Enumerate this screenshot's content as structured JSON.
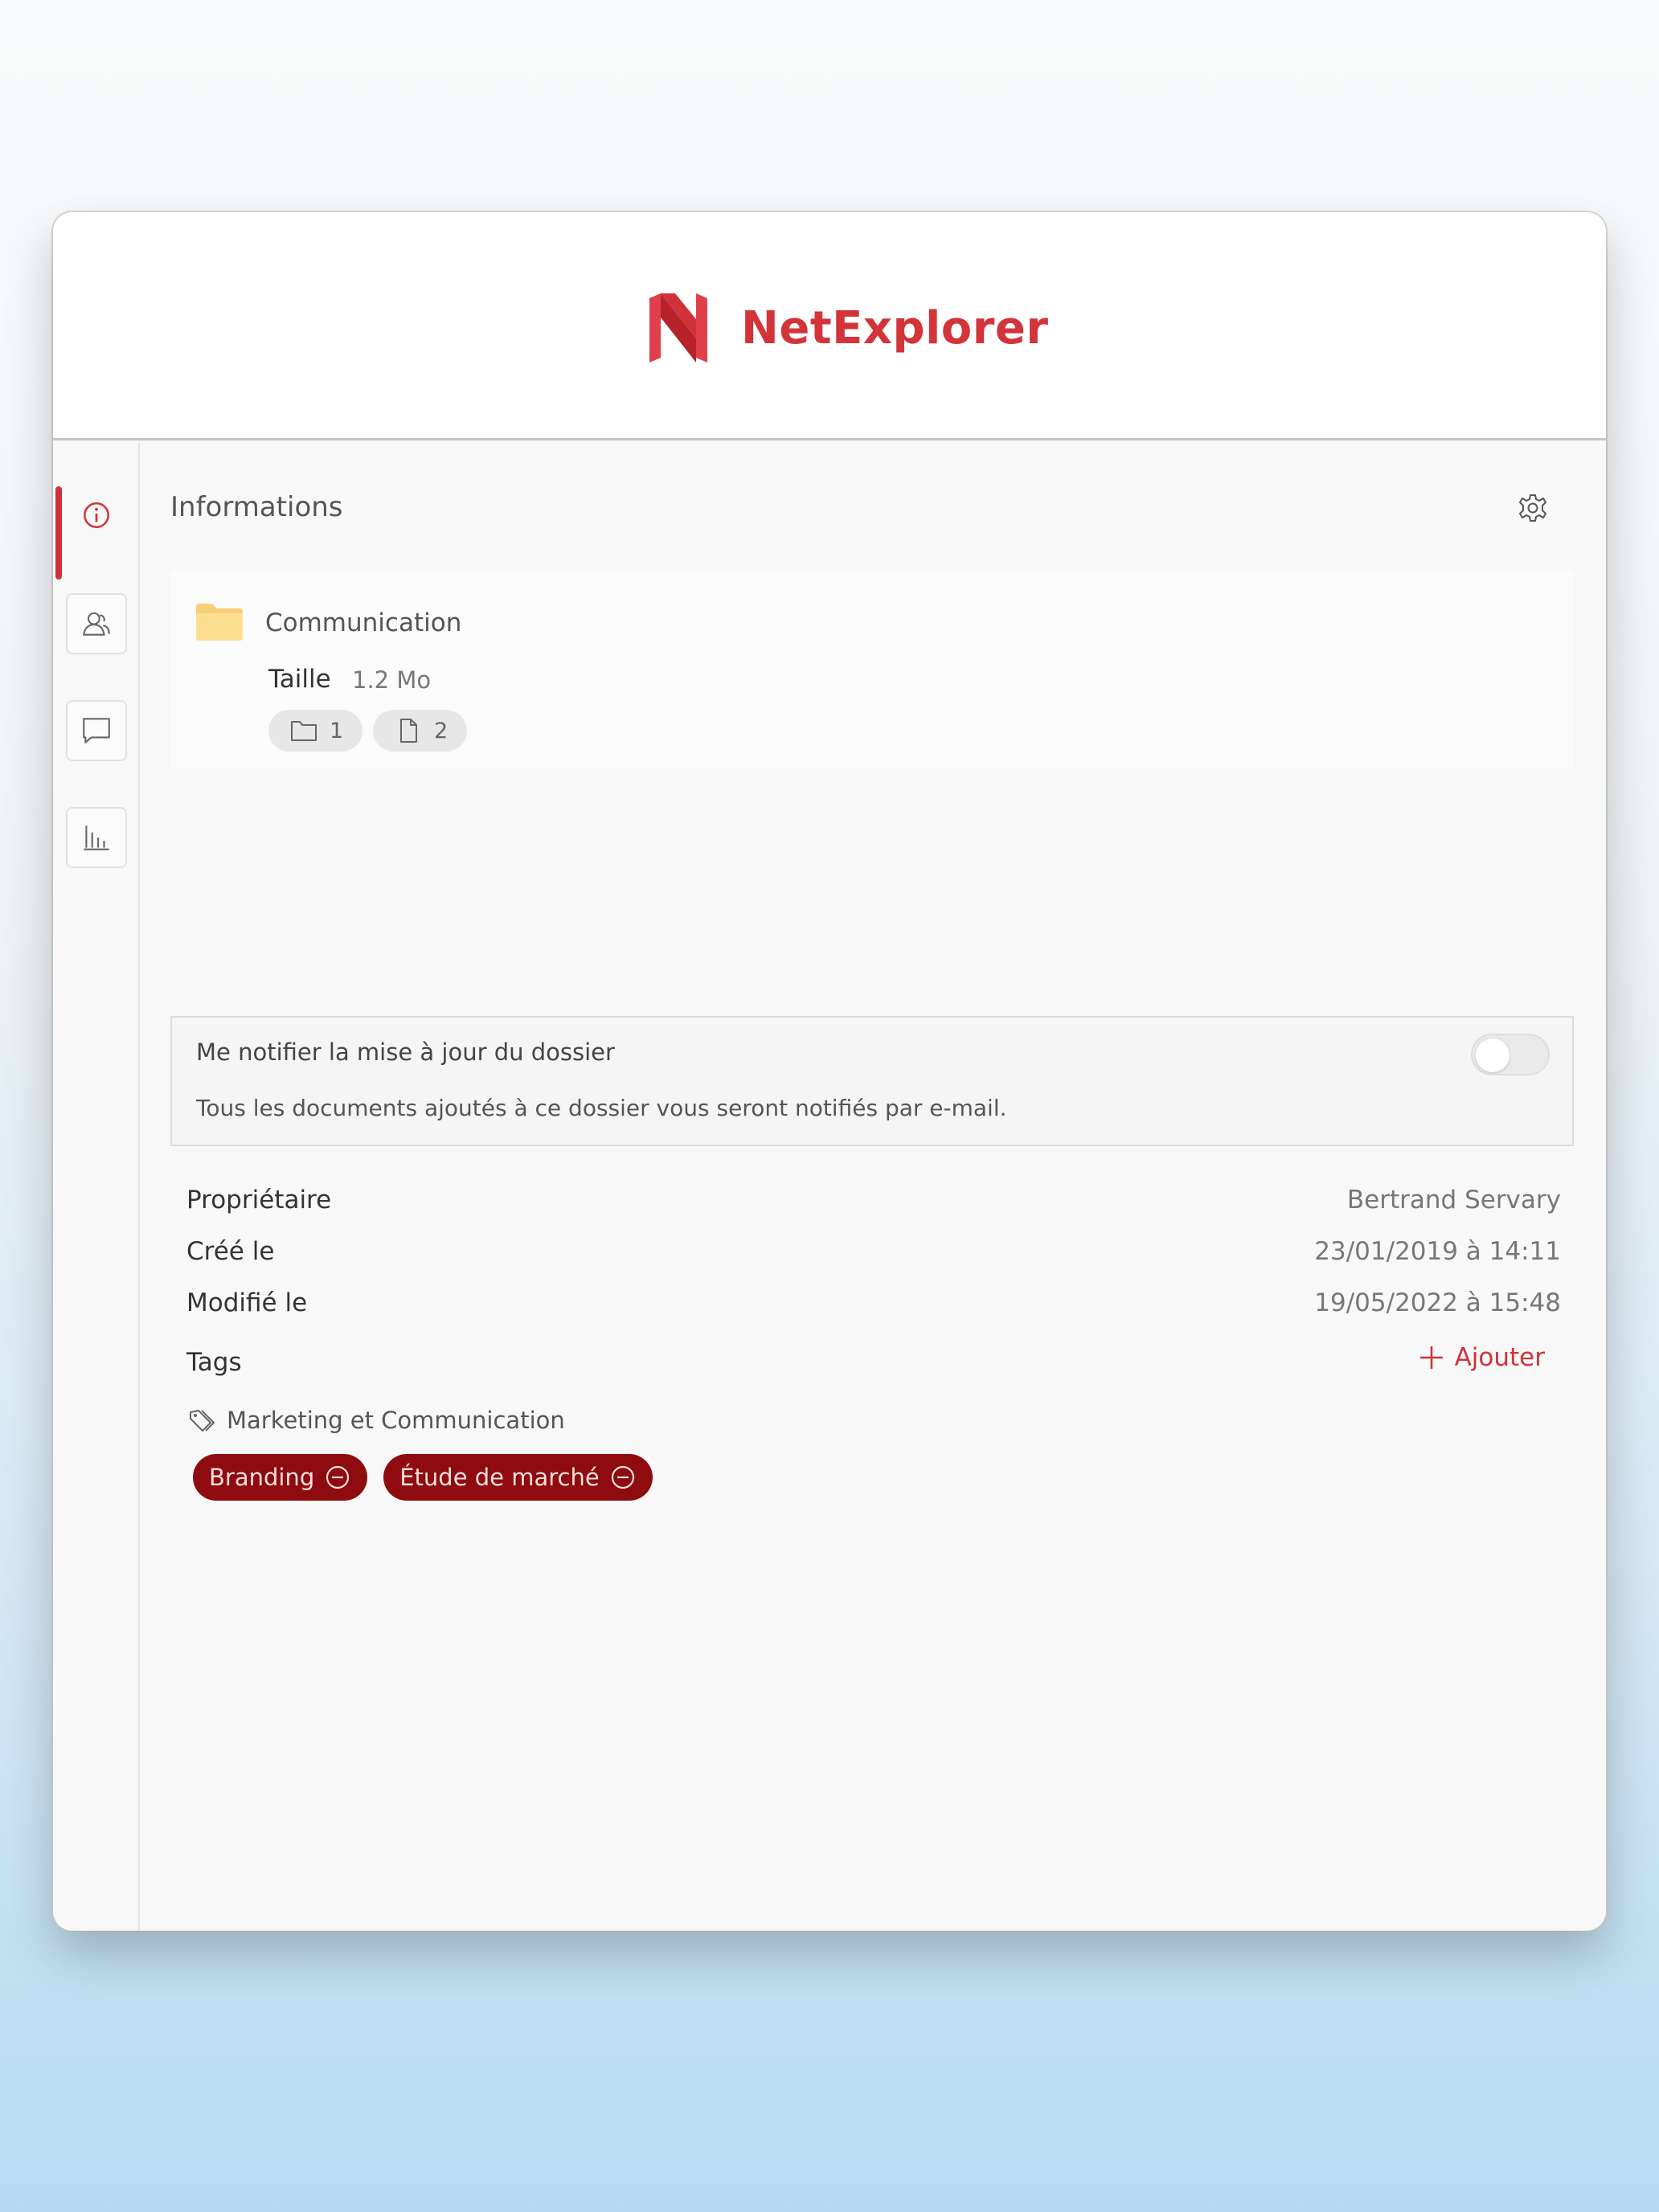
{
  "app": {
    "brand": "NetExplorer",
    "brand_color": "#d2343a"
  },
  "rail": {
    "items": [
      {
        "name": "info",
        "icon": "info-icon",
        "active": true
      },
      {
        "name": "users",
        "icon": "user-share-icon",
        "active": false
      },
      {
        "name": "comments",
        "icon": "comment-icon",
        "active": false
      },
      {
        "name": "stats",
        "icon": "bar-chart-icon",
        "active": false
      }
    ]
  },
  "panel": {
    "title": "Informations",
    "settings_icon": "gear-icon",
    "close_icon": "close-icon"
  },
  "folder": {
    "name": "Communication",
    "size_label": "Taille",
    "size_value": "1.2 Mo",
    "folder_count": "1",
    "file_count": "2"
  },
  "notify": {
    "title": "Me notifier la mise à jour du dossier",
    "description": "Tous les documents ajoutés à ce dossier vous seront notifiés par e-mail.",
    "enabled": false
  },
  "meta": {
    "owner_label": "Propriétaire",
    "owner_value": "Bertrand Servary",
    "created_label": "Créé le",
    "created_value": "23/01/2019 à 14:11",
    "modified_label": "Modifié le",
    "modified_value": "19/05/2022 à 15:48"
  },
  "tags": {
    "label": "Tags",
    "add_label": "Ajouter",
    "group_name": "Marketing et Communication",
    "chip_color": "#8e0b0f",
    "items": [
      {
        "label": "Branding"
      },
      {
        "label": "Étude de marché"
      }
    ]
  }
}
